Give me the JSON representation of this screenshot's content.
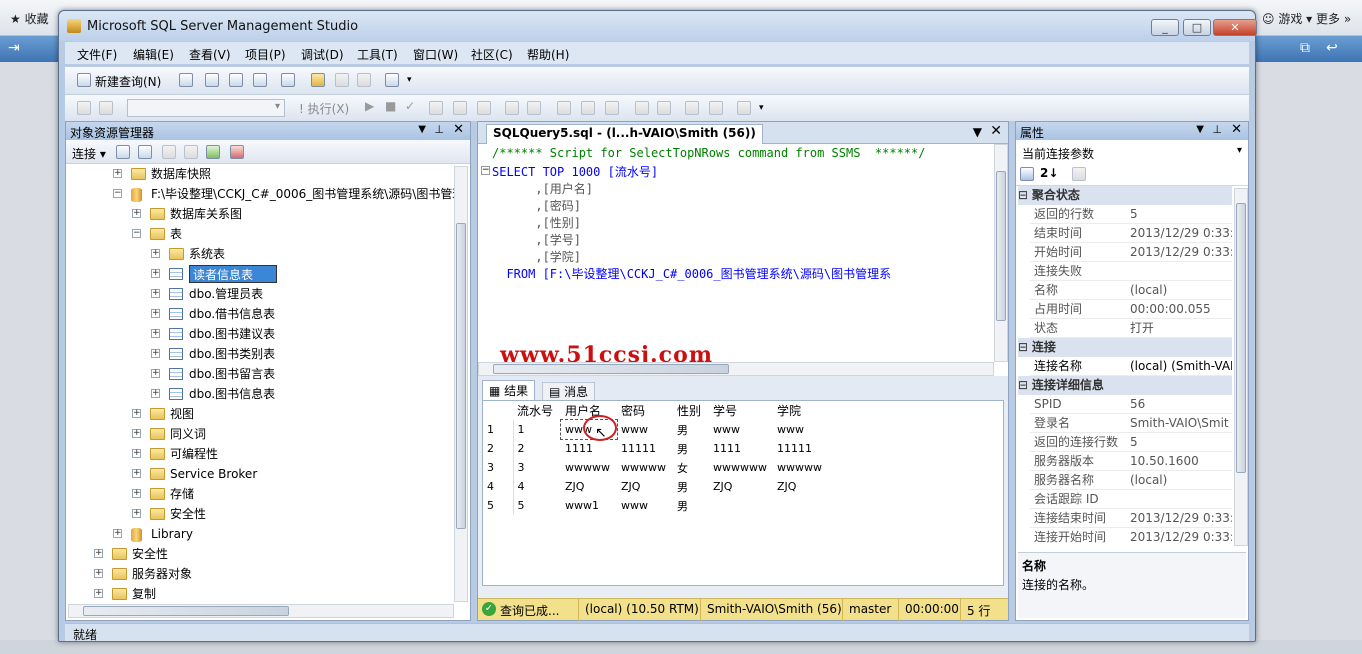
{
  "browser": {
    "fav_label": "收藏",
    "games_label": "游戏",
    "more_label": "更多"
  },
  "window": {
    "title": "Microsoft SQL Server Management Studio",
    "min": "▭",
    "max": "□",
    "close": "✕"
  },
  "menu": [
    "文件(F)",
    "编辑(E)",
    "查看(V)",
    "项目(P)",
    "调试(D)",
    "工具(T)",
    "窗口(W)",
    "社区(C)",
    "帮助(H)"
  ],
  "toolbar": {
    "new_query": "新建查询(N)",
    "execute": "执行(X)"
  },
  "object_explorer": {
    "title": "对象资源管理器",
    "connect": "连接",
    "items": [
      {
        "label": "数据库快照",
        "exp": "+"
      },
      {
        "label": "F:\\毕设整理\\CCKJ_C#_0006_图书管理系统\\源码\\图书管理",
        "exp": "−"
      },
      {
        "label": "数据库关系图",
        "exp": "+"
      },
      {
        "label": "表",
        "exp": "−"
      },
      {
        "label": "系统表",
        "exp": "+"
      },
      {
        "label": "读者信息表",
        "exp": "+"
      },
      {
        "label": "dbo.管理员表",
        "exp": "+"
      },
      {
        "label": "dbo.借书信息表",
        "exp": "+"
      },
      {
        "label": "dbo.图书建议表",
        "exp": "+"
      },
      {
        "label": "dbo.图书类别表",
        "exp": "+"
      },
      {
        "label": "dbo.图书留言表",
        "exp": "+"
      },
      {
        "label": "dbo.图书信息表",
        "exp": "+"
      },
      {
        "label": "视图",
        "exp": "+"
      },
      {
        "label": "同义词",
        "exp": "+"
      },
      {
        "label": "可编程性",
        "exp": "+"
      },
      {
        "label": "Service Broker",
        "exp": "+"
      },
      {
        "label": "存储",
        "exp": "+"
      },
      {
        "label": "安全性",
        "exp": "+"
      },
      {
        "label": "Library",
        "exp": "+"
      },
      {
        "label": "安全性",
        "exp": "+"
      },
      {
        "label": "服务器对象",
        "exp": "+"
      },
      {
        "label": "复制",
        "exp": "+"
      }
    ]
  },
  "editor": {
    "tab": "SQLQuery5.sql - (l...h-VAIO\\Smith (56))",
    "lines": [
      "/****** Script for SelectTopNRows command from SSMS  ******/",
      "SELECT TOP 1000 [流水号]",
      "      ,[用户名]",
      "      ,[密码]",
      "      ,[性别]",
      "      ,[学号]",
      "      ,[学院]",
      "  FROM [F:\\毕设整理\\CCKJ_C#_0006_图书管理系统\\源码\\图书管理系"
    ],
    "watermark": "www.51ccsj.com"
  },
  "results": {
    "tab_results": "结果",
    "tab_messages": "消息",
    "columns": [
      "流水号",
      "用户名",
      "密码",
      "性别",
      "学号",
      "学院"
    ],
    "rows": [
      [
        "1",
        "1",
        "www",
        "www",
        "男",
        "www",
        "www"
      ],
      [
        "2",
        "2",
        "1111",
        "11111",
        "男",
        "1111",
        "11111"
      ],
      [
        "3",
        "3",
        "wwwww",
        "wwwww",
        "女",
        "wwwwww",
        "wwwww"
      ],
      [
        "4",
        "4",
        "ZJQ",
        "ZJQ",
        "男",
        "ZJQ",
        "ZJQ"
      ],
      [
        "5",
        "5",
        "www1",
        "www",
        "男",
        "",
        ""
      ]
    ]
  },
  "status_bar": {
    "query": "查询已成...",
    "server": "(local) (10.50 RTM)",
    "user": "Smith-VAIO\\Smith (56)",
    "db": "master",
    "time": "00:00:00",
    "rows": "5 行"
  },
  "properties": {
    "title": "属性",
    "dropdown": "当前连接参数",
    "sections": [
      {
        "name": "聚合状态",
        "rows": [
          [
            "返回的行数",
            "5"
          ],
          [
            "结束时间",
            "2013/12/29 0:33:5"
          ],
          [
            "开始时间",
            "2013/12/29 0:33:5"
          ],
          [
            "连接失败",
            ""
          ],
          [
            "名称",
            "(local)"
          ],
          [
            "占用时间",
            "00:00:00.055"
          ],
          [
            "状态",
            "打开"
          ]
        ]
      },
      {
        "name": "连接",
        "rows": [
          [
            "连接名称",
            "(local) (Smith-VAI"
          ]
        ]
      },
      {
        "name": "连接详细信息",
        "rows": [
          [
            "SPID",
            "56"
          ],
          [
            "登录名",
            "Smith-VAIO\\Smit"
          ],
          [
            "返回的连接行数",
            "5"
          ],
          [
            "服务器版本",
            "10.50.1600"
          ],
          [
            "服务器名称",
            "(local)"
          ],
          [
            "会话跟踪 ID",
            ""
          ],
          [
            "连接结束时间",
            "2013/12/29 0:33:5"
          ],
          [
            "连接开始时间",
            "2013/12/29 0:33:5"
          ]
        ]
      }
    ],
    "desc_title": "名称",
    "desc_text": "连接的名称。"
  },
  "app_status": "就绪"
}
